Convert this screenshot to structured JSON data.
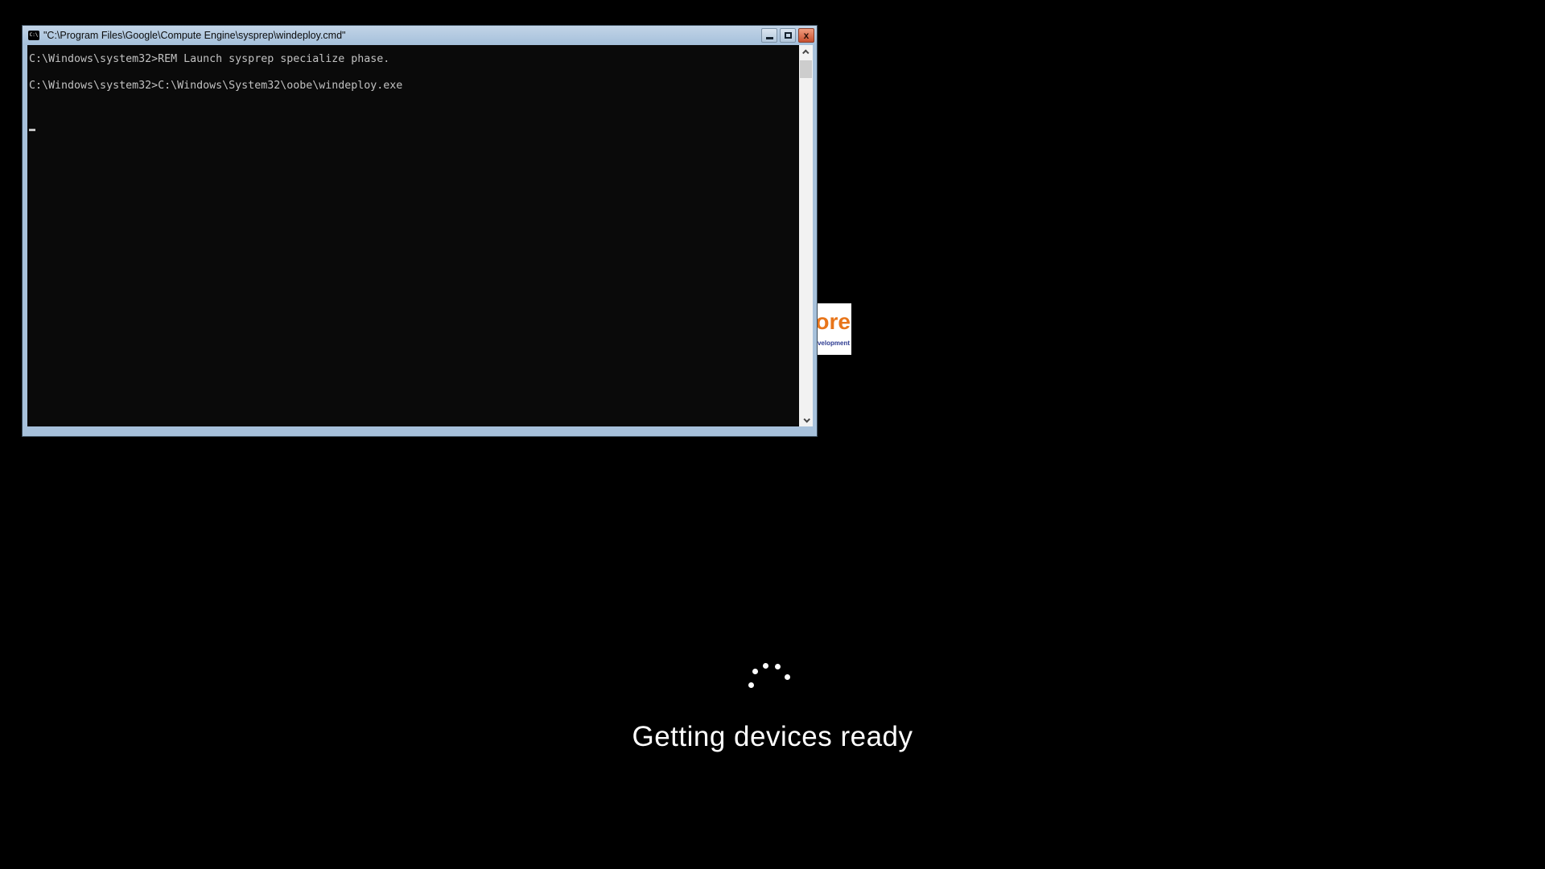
{
  "desktop": {
    "background_color": "#000000"
  },
  "console_window": {
    "title": "\"C:\\Program Files\\Google\\Compute Engine\\sysprep\\windeploy.cmd\"",
    "icon_glyph": "C:\\",
    "controls": {
      "close_glyph": "x"
    },
    "output_lines": [
      "C:\\Windows\\system32>REM Launch sysprep specialize phase.",
      "",
      "C:\\Windows\\system32>C:\\Windows\\System32\\oobe\\windeploy.exe"
    ],
    "colors": {
      "frame": "#a7c1db",
      "console_background": "#0a0a0a",
      "console_text": "#c2c2c2",
      "close_button": "#c8502f"
    }
  },
  "background_window": {
    "large_text": "ore",
    "small_text": "velopment",
    "large_text_color": "#e8751a",
    "small_text_color": "#2b3990"
  },
  "oobe": {
    "status_message": "Getting devices ready",
    "spinner_color": "#ffffff"
  }
}
